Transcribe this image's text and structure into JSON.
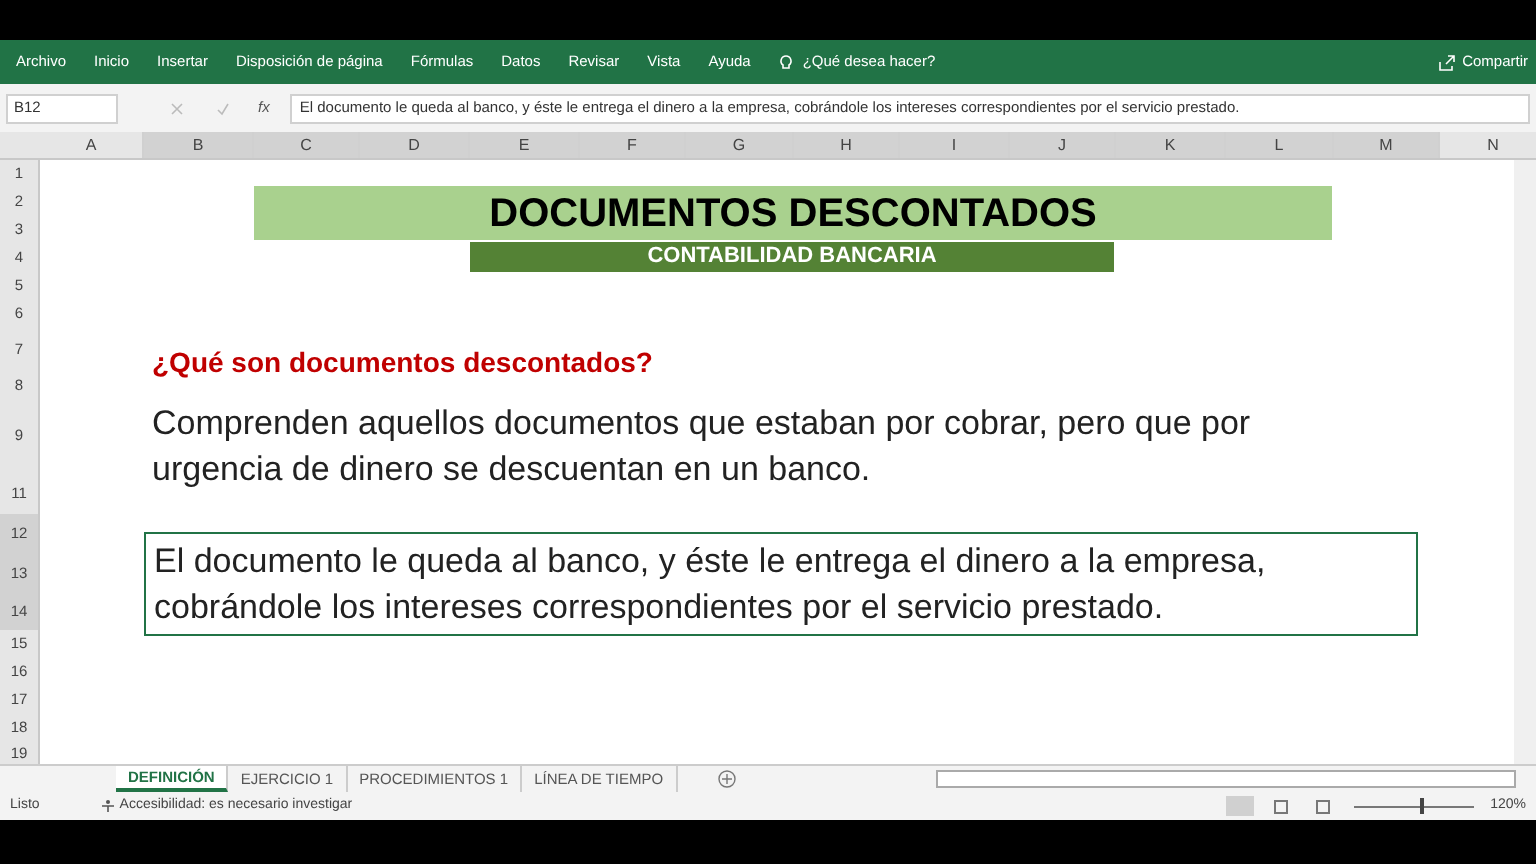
{
  "ribbon": {
    "tabs": [
      "Archivo",
      "Inicio",
      "Insertar",
      "Disposición de página",
      "Fórmulas",
      "Datos",
      "Revisar",
      "Vista",
      "Ayuda"
    ],
    "search": "¿Qué desea hacer?",
    "share": "Compartir"
  },
  "formula_bar": {
    "name_box": "B12",
    "function_label": "fx",
    "formula": "El documento le queda al banco, y éste le entrega el dinero a la empresa, cobrándole los intereses correspondientes por el servicio prestado."
  },
  "columns": [
    "A",
    "B",
    "C",
    "D",
    "E",
    "F",
    "G",
    "H",
    "I",
    "J",
    "K",
    "L",
    "M",
    "N"
  ],
  "rows": [
    "1",
    "2",
    "3",
    "4",
    "5",
    "6",
    "7",
    "8",
    "9",
    "11",
    "12",
    "13",
    "14",
    "15",
    "16",
    "17",
    "18",
    "19"
  ],
  "sheet": {
    "title": "DOCUMENTOS DESCONTADOS",
    "subtitle": "CONTABILIDAD BANCARIA",
    "question": "¿Qué son documentos descontados?",
    "answer": "Comprenden aquellos documentos que estaban por cobrar, pero que por urgencia de dinero se descuentan en un banco.",
    "selected_cell_text": "El documento le queda al banco, y éste le entrega el dinero a la empresa, cobrándole los intereses correspondientes por el servicio prestado."
  },
  "sheet_tabs": [
    {
      "label": "DEFINICIÓN",
      "selected": true
    },
    {
      "label": "EJERCICIO 1",
      "selected": false
    },
    {
      "label": "PROCEDIMIENTOS 1",
      "selected": false
    },
    {
      "label": "LÍNEA DE TIEMPO",
      "selected": false
    }
  ],
  "status_bar": {
    "ready": "Listo",
    "accessibility": "Accesibilidad: es necesario investigar",
    "zoom": "120%",
    "zoom_slider": {
      "level": 0.55
    }
  }
}
